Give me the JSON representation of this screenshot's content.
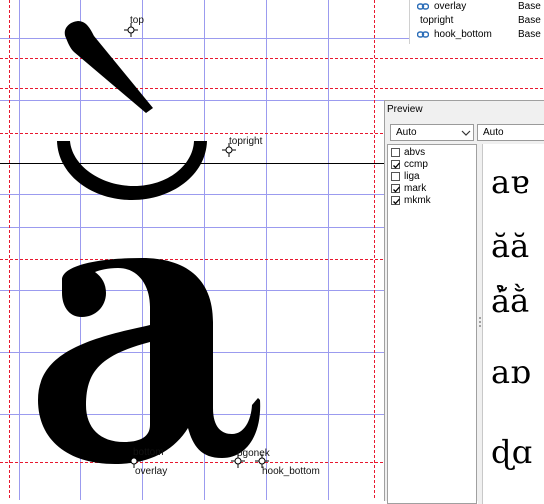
{
  "anchors": {
    "top": "top",
    "topright": "topright",
    "bottom": "bottom",
    "overlay": "overlay",
    "ogonek": "ogonek",
    "hook_bottom": "hook_bottom"
  },
  "anchor_list": [
    {
      "name": "overlay",
      "layer": "Base",
      "icon": "link-icon"
    },
    {
      "name": "topright",
      "layer": "Base",
      "icon": ""
    },
    {
      "name": "hook_bottom",
      "layer": "Base",
      "icon": "link-icon"
    }
  ],
  "preview": {
    "title": "Preview",
    "script_select": "Auto",
    "language_select": "Auto",
    "features": [
      {
        "tag": "abvs",
        "checked": false
      },
      {
        "tag": "ccmp",
        "checked": true
      },
      {
        "tag": "liga",
        "checked": false
      },
      {
        "tag": "mark",
        "checked": true
      },
      {
        "tag": "mkmk",
        "checked": true
      }
    ],
    "sample_rows": [
      "aɐ",
      "ăă",
      "ả̆ằ",
      "aɒ",
      "ɖɑ"
    ]
  },
  "colors": {
    "grid_blue": "#9b9bef",
    "guide_red": "#e8182f",
    "baseline": "#000000"
  }
}
